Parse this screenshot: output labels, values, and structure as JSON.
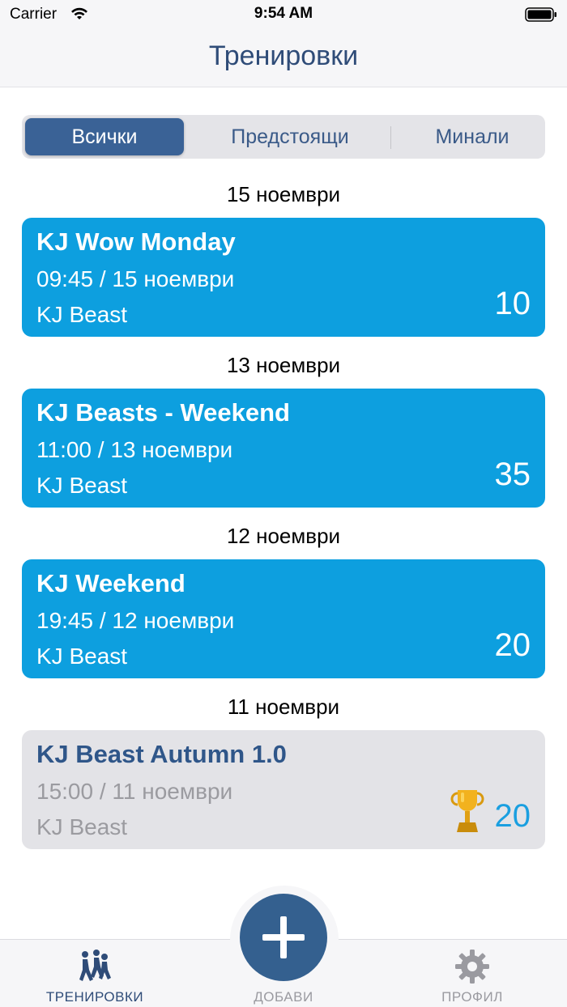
{
  "status_bar": {
    "carrier": "Carrier",
    "time": "9:54 AM"
  },
  "nav": {
    "title": "Тренировки"
  },
  "segments": {
    "all": "Всички",
    "upcoming": "Предстоящи",
    "past": "Минали",
    "selected": "all"
  },
  "sections": [
    {
      "date": "15 ноември",
      "card": {
        "title": "KJ Wow Monday",
        "time": "09:45 / 15 ноември",
        "club": "KJ Beast",
        "count": "10",
        "past": false
      }
    },
    {
      "date": "13 ноември",
      "card": {
        "title": "KJ Beasts - Weekend",
        "time": "11:00 / 13 ноември",
        "club": "KJ Beast",
        "count": "35",
        "past": false
      }
    },
    {
      "date": "12 ноември",
      "card": {
        "title": "KJ Weekend",
        "time": "19:45 / 12 ноември",
        "club": "KJ Beast",
        "count": "20",
        "past": false
      }
    },
    {
      "date": "11 ноември",
      "card": {
        "title": "KJ Beast Autumn 1.0",
        "time": "15:00 / 11 ноември",
        "club": "KJ Beast",
        "count": "20",
        "past": true,
        "icon": "trophy-icon"
      }
    }
  ],
  "tab_bar": {
    "workouts": {
      "label": "ТРЕНИРОВКИ",
      "icon": "people-icon"
    },
    "add": {
      "label": "ДОБАВИ",
      "icon": "plus-icon"
    },
    "profile": {
      "label": "ПРОФИЛ",
      "icon": "gear-icon"
    }
  },
  "colors": {
    "accent": "#34608f",
    "card_active": "#0d9fdf",
    "card_past": "#e3e3e7",
    "title_blue": "#2f4c78",
    "count_past": "#1a9fe0"
  }
}
